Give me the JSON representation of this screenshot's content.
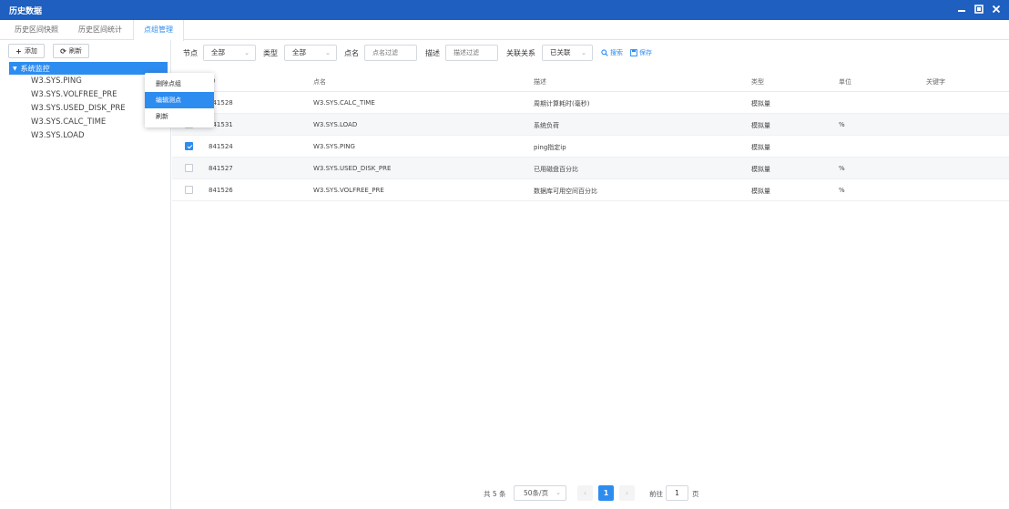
{
  "window": {
    "title": "历史数据"
  },
  "tabs": [
    {
      "label": "历史区间快照"
    },
    {
      "label": "历史区间统计"
    },
    {
      "label": "点组管理"
    }
  ],
  "sidebar": {
    "add_label": "添加",
    "refresh_label": "刷新",
    "root": "系统监控",
    "items": [
      "W3.SYS.PING",
      "W3.SYS.VOLFREE_PRE",
      "W3.SYS.USED_DISK_PRE",
      "W3.SYS.CALC_TIME",
      "W3.SYS.LOAD"
    ]
  },
  "context_menu": {
    "items": [
      "删除点组",
      "编辑测点",
      "刷新"
    ],
    "active_index": 1
  },
  "filters": {
    "node_label": "节点",
    "node_value": "全部",
    "type_label": "类型",
    "type_value": "全部",
    "name_label": "点名",
    "name_placeholder": "点名过滤",
    "desc_label": "描述",
    "desc_placeholder": "描述过滤",
    "relation_label": "关联关系",
    "relation_value": "已关联",
    "search_label": "搜索",
    "save_label": "保存"
  },
  "table": {
    "headers": {
      "id": "ID",
      "name": "点名",
      "desc": "描述",
      "type": "类型",
      "unit": "单位",
      "keyword": "关键字"
    },
    "rows": [
      {
        "checked": false,
        "id": "841528",
        "name": "W3.SYS.CALC_TIME",
        "desc": "周期计算耗时(毫秒)",
        "type": "模拟量",
        "unit": "",
        "keyword": ""
      },
      {
        "checked": false,
        "id": "841531",
        "name": "W3.SYS.LOAD",
        "desc": "系统负荷",
        "type": "模拟量",
        "unit": "%",
        "keyword": ""
      },
      {
        "checked": true,
        "id": "841524",
        "name": "W3.SYS.PING",
        "desc": "ping指定ip",
        "type": "模拟量",
        "unit": "",
        "keyword": ""
      },
      {
        "checked": false,
        "id": "841527",
        "name": "W3.SYS.USED_DISK_PRE",
        "desc": "已用磁盘百分比",
        "type": "模拟量",
        "unit": "%",
        "keyword": ""
      },
      {
        "checked": false,
        "id": "841526",
        "name": "W3.SYS.VOLFREE_PRE",
        "desc": "数据库可用空间百分比",
        "type": "模拟量",
        "unit": "%",
        "keyword": ""
      }
    ]
  },
  "pagination": {
    "total": "共 5 条",
    "page_size": "50条/页",
    "current": "1",
    "goto_label": "前往",
    "goto_value": "1",
    "page_suffix": "页"
  },
  "colors": {
    "titlebar": "#1f5fbf",
    "accent": "#2d8cf0"
  }
}
